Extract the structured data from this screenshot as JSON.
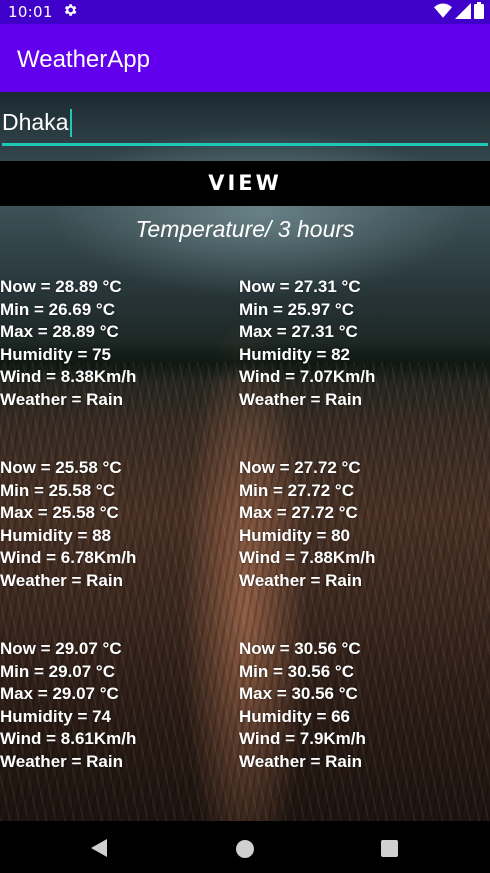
{
  "status_bar": {
    "time": "10:01",
    "icons": [
      "settings-gear-icon",
      "wifi-icon",
      "cellular-signal-icon",
      "battery-icon"
    ]
  },
  "app_bar": {
    "title": "WeatherApp"
  },
  "search": {
    "value": "Dhaka"
  },
  "view_button": {
    "label": "VIEW"
  },
  "section": {
    "title": "Temperature/ 3 hours"
  },
  "forecasts": [
    {
      "now": "Now = 28.89 °C",
      "min": "Min = 26.69 °C",
      "max": "Max = 28.89 °C",
      "humidity": "Humidity = 75",
      "wind": "Wind = 8.38Km/h",
      "weather": "Weather = Rain"
    },
    {
      "now": "Now = 27.31 °C",
      "min": "Min = 25.97 °C",
      "max": "Max = 27.31 °C",
      "humidity": "Humidity = 82",
      "wind": "Wind = 7.07Km/h",
      "weather": "Weather = Rain"
    },
    {
      "now": "Now = 25.58 °C",
      "min": "Min = 25.58 °C",
      "max": "Max = 25.58 °C",
      "humidity": "Humidity = 88",
      "wind": "Wind = 6.78Km/h",
      "weather": "Weather = Rain"
    },
    {
      "now": "Now = 27.72 °C",
      "min": "Min = 27.72 °C",
      "max": "Max = 27.72 °C",
      "humidity": "Humidity = 80",
      "wind": "Wind = 7.88Km/h",
      "weather": "Weather = Rain"
    },
    {
      "now": "Now = 29.07 °C",
      "min": "Min = 29.07 °C",
      "max": "Max = 29.07 °C",
      "humidity": "Humidity = 74",
      "wind": "Wind = 8.61Km/h",
      "weather": "Weather = Rain"
    },
    {
      "now": "Now = 30.56 °C",
      "min": "Min = 30.56 °C",
      "max": "Max = 30.56 °C",
      "humidity": "Humidity = 66",
      "wind": "Wind = 7.9Km/h",
      "weather": "Weather = Rain"
    }
  ],
  "colors": {
    "status_bar": "#3f00c9",
    "app_bar": "#6200ee",
    "input_underline": "#1ec8b6",
    "button_bg": "#000000",
    "text": "#ffffff"
  }
}
